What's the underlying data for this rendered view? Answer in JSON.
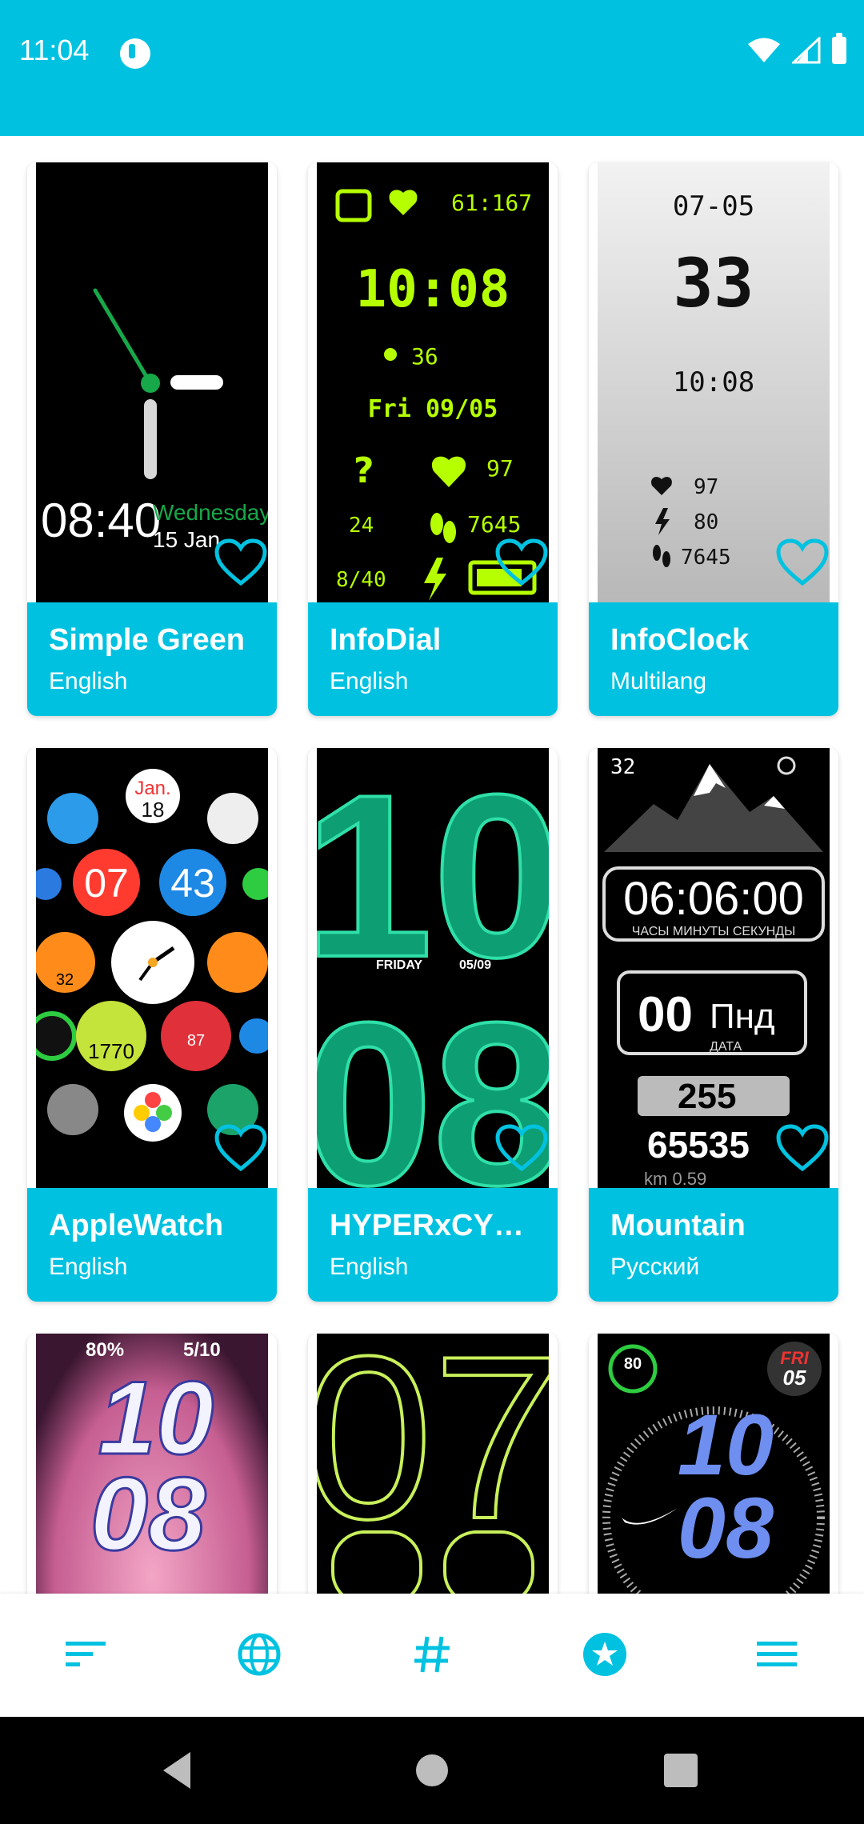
{
  "status": {
    "time": "11:04"
  },
  "colors": {
    "accent": "#00C2E0",
    "background": "#FFFFFF",
    "heart": "#00C2E0"
  },
  "cards": [
    {
      "title": "Simple Green",
      "language": "English",
      "preview": "simple-green",
      "texts": {
        "time": "08:40",
        "day": "Wednesday",
        "date": "15 Jan"
      }
    },
    {
      "title": "InfoDial",
      "language": "English",
      "preview": "infodial",
      "texts": {
        "top": "61:167",
        "time": "10:08",
        "steps_small": "36",
        "date": "Fri 09/05",
        "hr": "97",
        "left": "24",
        "steps": "7645",
        "bottom": "8/40"
      }
    },
    {
      "title": "InfoClock",
      "language": "Multilang",
      "preview": "infoclock",
      "texts": {
        "date": "07-05",
        "day": "33",
        "time": "10:08",
        "hr": "97",
        "bolt": "80",
        "steps": "7645"
      }
    },
    {
      "title": "AppleWatch",
      "language": "English",
      "preview": "applewatch",
      "texts": {
        "month": "Jan.",
        "day": "18",
        "hour": "07",
        "min": "43",
        "bat": "32",
        "steps": "1770",
        "hr": "87"
      }
    },
    {
      "title": "HYPERxCY…",
      "language": "English",
      "preview": "hyper",
      "texts": {
        "hour": "10",
        "min": "08",
        "day": "FRIDAY",
        "date": "05/09"
      }
    },
    {
      "title": "Mountain",
      "language": "Русский",
      "preview": "mountain",
      "texts": {
        "top": "32",
        "time": "06:06:00",
        "labels": "ЧАСЫ  МИНУТЫ  СЕКУНДЫ",
        "day": "00",
        "dow": "Пнд",
        "date_label": "ДАТА",
        "hr": "255",
        "steps": "65535",
        "km": "km 0.59"
      }
    },
    {
      "title": "",
      "language": "",
      "preview": "pink",
      "texts": {
        "bat": "80%",
        "date": "5/10",
        "hour": "10",
        "min": "08"
      }
    },
    {
      "title": "",
      "language": "",
      "preview": "outline",
      "texts": {
        "hour": "07"
      }
    },
    {
      "title": "",
      "language": "",
      "preview": "sport",
      "texts": {
        "bat": "80",
        "day": "FRI",
        "date": "05",
        "hour": "10",
        "min": "08"
      }
    }
  ],
  "bottom_nav": [
    {
      "name": "sort",
      "icon": "sort-icon"
    },
    {
      "name": "language",
      "icon": "globe-icon"
    },
    {
      "name": "tags",
      "icon": "hashtag-icon"
    },
    {
      "name": "favorites",
      "icon": "star-badge-icon"
    },
    {
      "name": "menu",
      "icon": "menu-icon"
    }
  ],
  "system_nav": [
    "back",
    "home",
    "recents"
  ]
}
